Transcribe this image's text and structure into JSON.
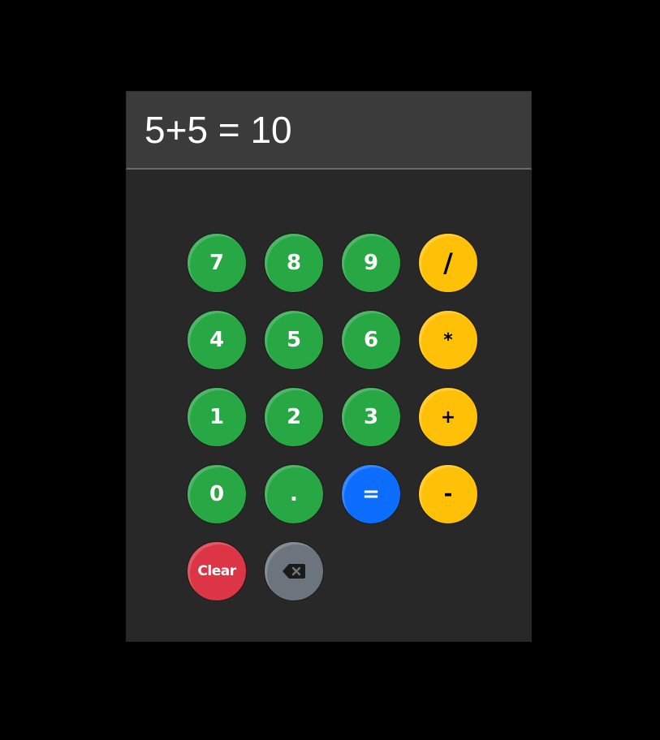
{
  "display": {
    "text": "5+5 = 10"
  },
  "keys": [
    {
      "label": "7",
      "kind": "number"
    },
    {
      "label": "8",
      "kind": "number"
    },
    {
      "label": "9",
      "kind": "number"
    },
    {
      "label": "/",
      "kind": "operator"
    },
    {
      "label": "4",
      "kind": "number"
    },
    {
      "label": "5",
      "kind": "number"
    },
    {
      "label": "6",
      "kind": "number"
    },
    {
      "label": "*",
      "kind": "operator"
    },
    {
      "label": "1",
      "kind": "number"
    },
    {
      "label": "2",
      "kind": "number"
    },
    {
      "label": "3",
      "kind": "number"
    },
    {
      "label": "+",
      "kind": "operator"
    },
    {
      "label": "0",
      "kind": "number"
    },
    {
      "label": ".",
      "kind": "number"
    },
    {
      "label": "=",
      "kind": "equals"
    },
    {
      "label": "-",
      "kind": "operator"
    },
    {
      "label": "Clear",
      "kind": "clear"
    },
    {
      "label": "",
      "kind": "backspace",
      "icon": "backspace-icon"
    }
  ],
  "colors": {
    "background": "#000000",
    "panel": "#282828",
    "display": "#3b3b3b",
    "number": "#28a745",
    "operator": "#ffc107",
    "equals": "#0d6efd",
    "clear": "#dc3545",
    "backspace": "#6c757d"
  }
}
